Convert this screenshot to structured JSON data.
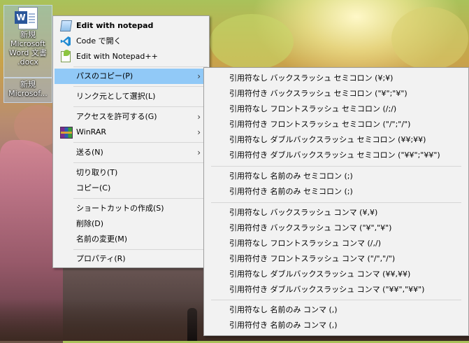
{
  "desktop": {
    "icons": [
      {
        "label_lines": [
          "新規",
          "Microsoft",
          "Word 文書",
          ".docx"
        ],
        "app": "word-icon"
      },
      {
        "label_lines": [
          "新規",
          "Microsof..."
        ],
        "app": "word-icon"
      }
    ]
  },
  "context_menu": {
    "items": [
      {
        "label": "Edit with notepad",
        "icon": "notepad-icon",
        "bold": true
      },
      {
        "label": "Code で開く",
        "icon": "vscode-icon"
      },
      {
        "label": "Edit with Notepad++",
        "icon": "notepadpp-icon"
      },
      {
        "label": "パスのコピー(P)",
        "submenu": true,
        "highlighted": true
      },
      {
        "label": "リンク元として選択(L)"
      },
      {
        "label": "アクセスを許可する(G)",
        "submenu": true
      },
      {
        "label": "WinRAR",
        "icon": "winrar-icon",
        "submenu": true
      },
      {
        "label": "送る(N)",
        "submenu": true
      },
      {
        "label": "切り取り(T)"
      },
      {
        "label": "コピー(C)"
      },
      {
        "label": "ショートカットの作成(S)"
      },
      {
        "label": "削除(D)"
      },
      {
        "label": "名前の変更(M)"
      },
      {
        "label": "プロパティ(R)"
      }
    ]
  },
  "submenu": {
    "items": [
      "引用符なし バックスラッシュ セミコロン (¥;¥)",
      "引用符付き バックスラッシュ セミコロン (\"¥\";\"¥\")",
      "引用符なし フロントスラッシュ セミコロン (/;/)",
      "引用符付き フロントスラッシュ セミコロン (\"/\";\"/\")",
      "引用符なし ダブルバックスラッシュ セミコロン (¥¥;¥¥)",
      "引用符付き ダブルバックスラッシュ セミコロン (\"¥¥\";\"¥¥\")",
      "引用符なし 名前のみ セミコロン (;)",
      "引用符付き 名前のみ セミコロン (;)",
      "引用符なし バックスラッシュ コンマ (¥,¥)",
      "引用符付き バックスラッシュ コンマ (\"¥\",\"¥\")",
      "引用符なし フロントスラッシュ コンマ (/,/)",
      "引用符付き フロントスラッシュ コンマ (\"/\",\"/\")",
      "引用符なし ダブルバックスラッシュ コンマ (¥¥,¥¥)",
      "引用符付き ダブルバックスラッシュ コンマ (\"¥¥\",\"¥¥\")",
      "引用符なし 名前のみ コンマ (,)",
      "引用符付き 名前のみ コンマ (,)"
    ]
  },
  "colors": {
    "highlight": "#91c9f7",
    "menu_bg": "#f2f2f2"
  }
}
